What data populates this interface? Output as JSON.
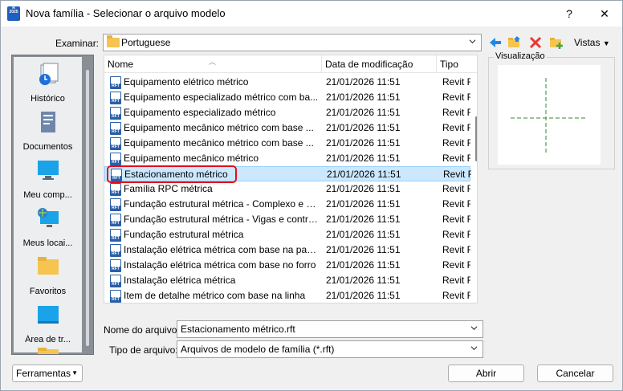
{
  "window": {
    "title": "Nova família - Selecionar o arquivo modelo",
    "app_icon_letter": "R",
    "app_icon_sub": "2025",
    "help_glyph": "?",
    "close_glyph": "✕"
  },
  "toolbar": {
    "look_in_label": "Examinar:",
    "look_in_value": "Portuguese",
    "vistas_label": "Vistas",
    "icons": [
      "back-arrow-icon",
      "up-folder-icon",
      "delete-icon",
      "new-folder-icon"
    ],
    "colors": {
      "back": "#1e88e5",
      "delete": "#e53935",
      "folder": "#f5c451",
      "new": "#3fa84a"
    }
  },
  "places": [
    {
      "label": "Histórico",
      "icon": "history-icon"
    },
    {
      "label": "Documentos",
      "icon": "documents-icon"
    },
    {
      "label": "Meu comp...",
      "icon": "computer-icon"
    },
    {
      "label": "Meus locai...",
      "icon": "network-icon"
    },
    {
      "label": "Favoritos",
      "icon": "favorites-folder-icon"
    },
    {
      "label": "Área de tr...",
      "icon": "desktop-icon"
    }
  ],
  "file_list": {
    "columns": {
      "name": "Nome",
      "date": "Data de modificação",
      "type": "Tipo"
    },
    "rows": [
      {
        "name": "Equipamento elétrico métrico",
        "date": "21/01/2026 11:51",
        "type": "Revit F"
      },
      {
        "name": "Equipamento especializado métrico com ba...",
        "date": "21/01/2026 11:51",
        "type": "Revit F"
      },
      {
        "name": "Equipamento especializado métrico",
        "date": "21/01/2026 11:51",
        "type": "Revit F"
      },
      {
        "name": "Equipamento mecânico métrico com base ...",
        "date": "21/01/2026 11:51",
        "type": "Revit F"
      },
      {
        "name": "Equipamento mecânico métrico com base ...",
        "date": "21/01/2026 11:51",
        "type": "Revit F"
      },
      {
        "name": "Equipamento mecânico métrico",
        "date": "21/01/2026 11:51",
        "type": "Revit F"
      },
      {
        "name": "Estacionamento métrico",
        "date": "21/01/2026 11:51",
        "type": "Revit F"
      },
      {
        "name": "Família RPC métrica",
        "date": "21/01/2026 11:51",
        "type": "Revit F"
      },
      {
        "name": "Fundação estrutural métrica - Complexo e a...",
        "date": "21/01/2026 11:51",
        "type": "Revit F"
      },
      {
        "name": "Fundação estrutural métrica - Vigas e contra...",
        "date": "21/01/2026 11:51",
        "type": "Revit F"
      },
      {
        "name": "Fundação estrutural métrica",
        "date": "21/01/2026 11:51",
        "type": "Revit F"
      },
      {
        "name": "Instalação elétrica métrica com base na pare...",
        "date": "21/01/2026 11:51",
        "type": "Revit F"
      },
      {
        "name": "Instalação elétrica métrica com base no forro",
        "date": "21/01/2026 11:51",
        "type": "Revit F"
      },
      {
        "name": "Instalação elétrica métrica",
        "date": "21/01/2026 11:51",
        "type": "Revit F"
      },
      {
        "name": "Item de detalhe métrico com base na linha",
        "date": "21/01/2026 11:51",
        "type": "Revit F"
      }
    ],
    "selected_index": 6,
    "highlight_color": "#e0101a"
  },
  "preview": {
    "label": "Visualização",
    "line_color": "#2e8b2e"
  },
  "fields": {
    "filename_label": "Nome do arquivo:",
    "filename_value": "Estacionamento métrico.rft",
    "filetype_label": "Tipo de arquivo:",
    "filetype_value": "Arquivos de modelo de família (*.rft)"
  },
  "buttons": {
    "tools": "Ferramentas",
    "open": "Abrir",
    "cancel": "Cancelar"
  }
}
